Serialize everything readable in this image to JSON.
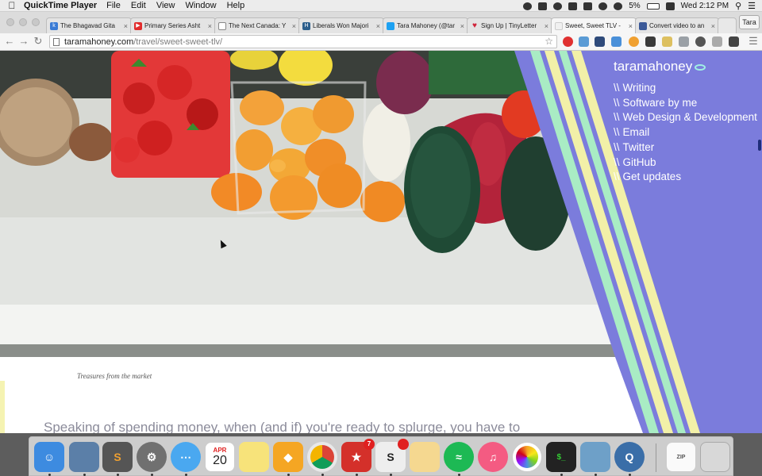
{
  "menubar": {
    "app_name": "QuickTime Player",
    "items": [
      "File",
      "Edit",
      "View",
      "Window",
      "Help"
    ],
    "battery": "5%",
    "clock": "Wed 2:12 PM"
  },
  "tabs": [
    {
      "label": "The Bhagavad Gita",
      "favicon": "k",
      "color": "#3a7bd5"
    },
    {
      "label": "Primary Series Asht",
      "favicon": "",
      "color": "#e12b2b"
    },
    {
      "label": "The Next Canada: Y",
      "favicon": "",
      "color": "#888888"
    },
    {
      "label": "Liberals Won Majori",
      "favicon": "H",
      "color": "#2b5e8c"
    },
    {
      "label": "Tara Mahoney (@tar",
      "favicon": "",
      "color": "#1da1f2"
    },
    {
      "label": "Sign Up | TinyLetter",
      "favicon": "",
      "color": "#d0243b"
    },
    {
      "label": "Sweet, Sweet TLV -",
      "favicon": "",
      "color": "#dddddd"
    },
    {
      "label": "Convert video to an",
      "favicon": "",
      "color": "#3b5998"
    }
  ],
  "profile_button": "Tara",
  "address": {
    "domain": "taramahoney.com",
    "path": "/travel/sweet-sweet-tlv/"
  },
  "site": {
    "logo": "taramahoney",
    "nav_prefix": "\\\\",
    "nav": [
      "Writing",
      "Software by me",
      "Web Design & Development",
      "Email",
      "Twitter",
      "GitHub",
      "Get updates"
    ]
  },
  "article": {
    "caption": "Treasures from the market",
    "body_line": "Speaking of spending money, when (and if) you're ready to splurge, you have to"
  },
  "dock": {
    "calendar_month": "APR",
    "calendar_day": "20",
    "wunderlist_badge": "7"
  },
  "colors": {
    "nav_purple": "#7b7cdc",
    "stripe_yellow": "#f2f0a8",
    "stripe_mint": "#a9ecc4"
  }
}
